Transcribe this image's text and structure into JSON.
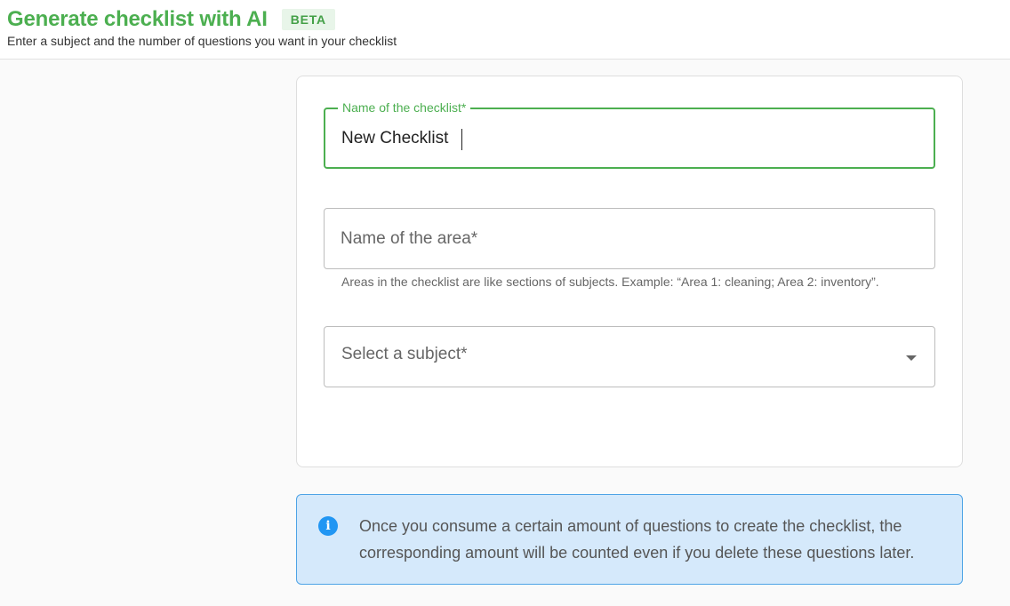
{
  "header": {
    "title": "Generate checklist with AI",
    "badge": "BETA",
    "subtitle": "Enter a subject and the number of questions you want in your checklist"
  },
  "form": {
    "checklist_name": {
      "label": "Name of the checklist*",
      "value": "New Checklist"
    },
    "area_name": {
      "placeholder": "Name of the area*",
      "helper": " Areas in the checklist are like sections of subjects. Example: “Area 1: cleaning; Area 2: inventory”."
    },
    "subject": {
      "placeholder": "Select a subject*",
      "icon": "chevron-down-icon"
    }
  },
  "info": {
    "icon": "info-icon",
    "text": "Once you consume a certain amount of questions to create the checklist, the corresponding amount will be counted even if you delete these questions later."
  },
  "colors": {
    "accent": "#4caf50",
    "info_background": "#d5e9fb",
    "info_border": "#4ea3e6",
    "info_icon": "#2196f3"
  }
}
